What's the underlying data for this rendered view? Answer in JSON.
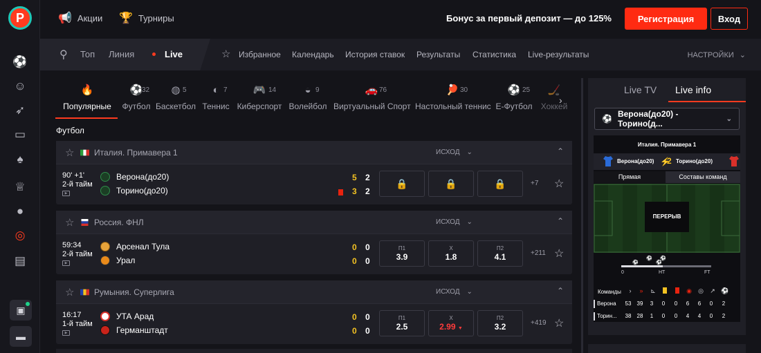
{
  "topbar": {
    "promos_label": "Акции",
    "tournaments_label": "Турниры",
    "bonus_text": "Бонус за первый депозит — до 125%",
    "register_label": "Регистрация",
    "login_label": "Вход"
  },
  "nav": {
    "top_label": "Топ",
    "line_label": "Линия",
    "live_label": "Live",
    "links": [
      "Избранное",
      "Календарь",
      "История ставок",
      "Результаты",
      "Статистика",
      "Live-результаты"
    ],
    "settings_label": "НАСТРОЙКИ"
  },
  "sports": [
    {
      "label": "Популярные",
      "count": "",
      "icon": "fire-icon",
      "active": true
    },
    {
      "label": "Футбол",
      "count": "32",
      "icon": "soccer-ball-icon"
    },
    {
      "label": "Баскетбол",
      "count": "5",
      "icon": "basketball-icon"
    },
    {
      "label": "Теннис",
      "count": "7",
      "icon": "tennis-ball-icon"
    },
    {
      "label": "Киберспорт",
      "count": "14",
      "icon": "gamepad-icon"
    },
    {
      "label": "Волейбол",
      "count": "9",
      "icon": "volleyball-icon"
    },
    {
      "label": "Виртуальный Спорт",
      "count": "76",
      "icon": "car-icon"
    },
    {
      "label": "Настольный теннис",
      "count": "30",
      "icon": "ping-pong-icon"
    },
    {
      "label": "Е-Футбол",
      "count": "25",
      "icon": "efootball-icon"
    },
    {
      "label": "Хоккей",
      "count": "",
      "icon": "hockey-icon"
    }
  ],
  "section_title": "Футбол",
  "outcome_label": "ИСХОД",
  "leagues": [
    {
      "name": "Италия. Примавера 1",
      "match": {
        "time": "90' +1'",
        "period": "2-й тайм",
        "team1": "Верона(до20)",
        "team2": "Торино(до20)",
        "score1": [
          "5",
          "2"
        ],
        "score2": [
          "3",
          "2"
        ],
        "more": "+7",
        "odds": []
      }
    },
    {
      "name": "Россия. ФНЛ",
      "match": {
        "time": "59:34",
        "period": "2-й тайм",
        "team1": "Арсенал Тула",
        "team2": "Урал",
        "score1": [
          "0",
          "0"
        ],
        "score2": [
          "0",
          "0"
        ],
        "more": "+211",
        "odds": [
          {
            "label": "П1",
            "value": "3.9"
          },
          {
            "label": "Х",
            "value": "1.8"
          },
          {
            "label": "П2",
            "value": "4.1"
          }
        ]
      }
    },
    {
      "name": "Румыния. Суперлига",
      "match": {
        "time": "16:17",
        "period": "1-й тайм",
        "team1": "УТА Арад",
        "team2": "Германштадт",
        "score1": [
          "0",
          "0"
        ],
        "score2": [
          "0",
          "0"
        ],
        "more": "+419",
        "odds": [
          {
            "label": "П1",
            "value": "2.5"
          },
          {
            "label": "Х",
            "value": "2.99"
          },
          {
            "label": "П2",
            "value": "3.2"
          }
        ]
      }
    }
  ],
  "right_panel": {
    "tab_tv": "Live TV",
    "tab_info": "Live info",
    "selected_match": "Верона(до20) - Торино(д...",
    "widget": {
      "league": "Италия. Примавера 1",
      "team1": "Верона(до20)",
      "team2": "Торино(до20)",
      "score1": "2",
      "score2": "2",
      "tab_straight": "Прямая",
      "tab_lineups": "Составы команд",
      "status": "ПЕРЕРЫВ",
      "timeline_labels": [
        "0",
        "HT",
        "FT"
      ],
      "stats_header": "Команды",
      "rows": [
        {
          "team": "Верона",
          "values": [
            "53",
            "39",
            "3",
            "0",
            "0",
            "6",
            "6",
            "0",
            "2"
          ]
        },
        {
          "team": "Торин...",
          "values": [
            "38",
            "28",
            "1",
            "0",
            "0",
            "4",
            "4",
            "0",
            "2"
          ]
        }
      ]
    }
  },
  "colors": {
    "accent": "#ff2b12",
    "score_yellow": "#f3c222",
    "odd_red": "#ff3b3b"
  }
}
